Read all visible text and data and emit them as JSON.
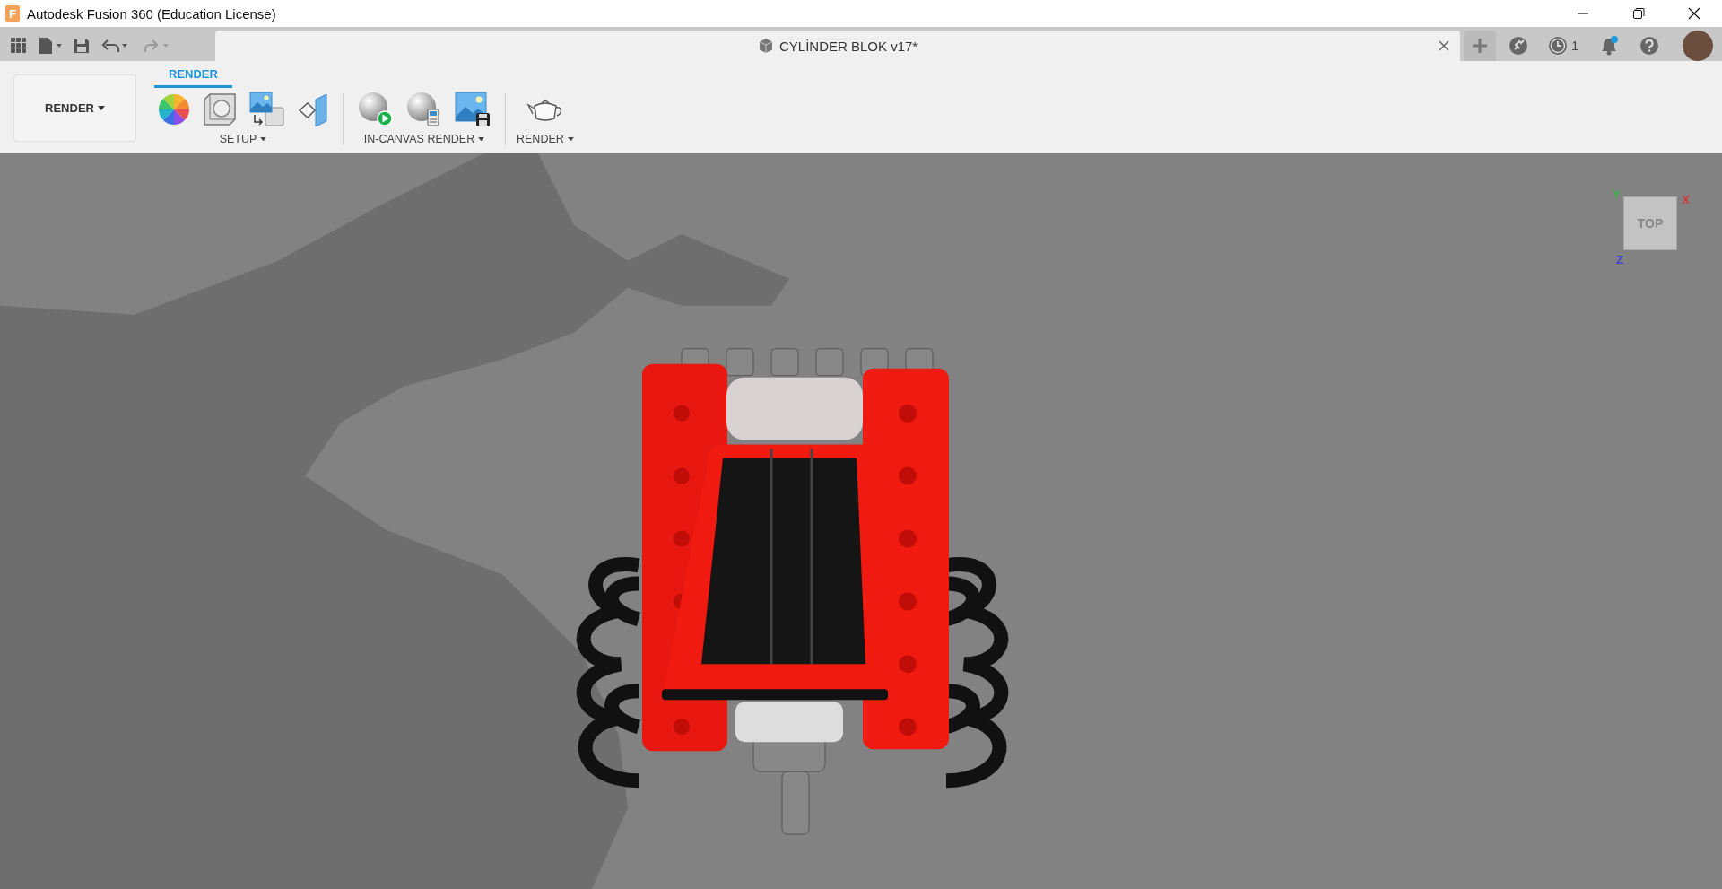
{
  "window": {
    "app_icon": "F",
    "title": "Autodesk Fusion 360 (Education License)"
  },
  "document_tab": {
    "title": "CYLİNDER BLOK v17*"
  },
  "top_bar": {
    "jobs_count": "1",
    "notifications_unread": true
  },
  "workspace": {
    "label": "RENDER"
  },
  "toolbar_tabs": [
    {
      "label": "RENDER",
      "selected": true
    }
  ],
  "tool_groups": [
    {
      "label": "SETUP",
      "tools": [
        {
          "kind": "appearance"
        },
        {
          "kind": "scene"
        },
        {
          "kind": "texture"
        },
        {
          "kind": "decal"
        }
      ]
    },
    {
      "label": "IN-CANVAS RENDER",
      "tools": [
        {
          "kind": "render-start"
        },
        {
          "kind": "render-settings"
        },
        {
          "kind": "capture"
        }
      ]
    },
    {
      "label": "RENDER",
      "tools": [
        {
          "kind": "teapot"
        }
      ]
    }
  ],
  "view_cube": {
    "face": "TOP",
    "axes": [
      "Y",
      "X",
      "Z"
    ]
  }
}
